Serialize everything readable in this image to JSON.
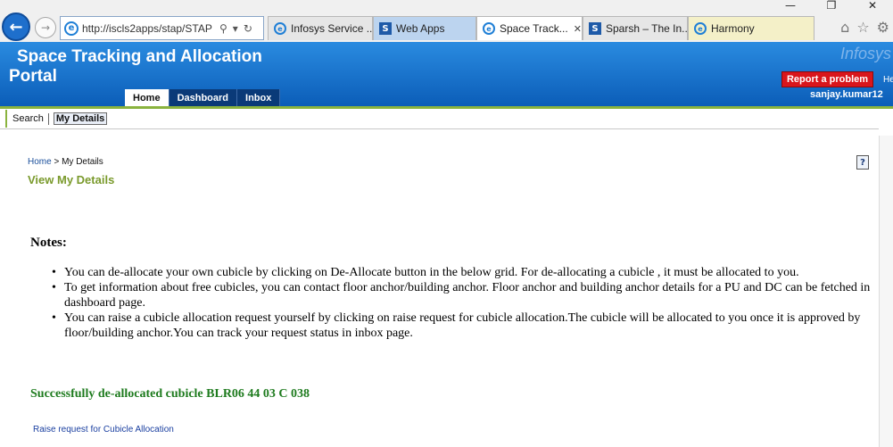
{
  "browser": {
    "address_url": "http://iscls2apps/stap/STAP",
    "tabs": [
      {
        "label": "Infosys Service ...",
        "icon": "ie-icon"
      },
      {
        "label": "Web Apps",
        "icon": "sharepoint-icon"
      },
      {
        "label": "Space Track...",
        "icon": "ie-icon"
      },
      {
        "label": "Sparsh – The In...",
        "icon": "sharepoint-icon"
      },
      {
        "label": "Harmony",
        "icon": "ie-icon"
      }
    ]
  },
  "header": {
    "title_line1": "Space Tracking and Allocation",
    "title_line2": "Portal",
    "brand": "Infosys",
    "report_button": "Report a problem",
    "help_link": "He",
    "user": "sanjay.kumar12"
  },
  "main_nav": [
    "Home",
    "Dashboard",
    "Inbox"
  ],
  "sub_nav": {
    "search": "Search",
    "my_details": "My Details"
  },
  "breadcrumb": {
    "home": "Home",
    "separator": " > ",
    "current": "My Details"
  },
  "page_title": "View My Details",
  "notes": {
    "title": "Notes:",
    "items": [
      "You can de-allocate your own cubicle by clicking on De-Allocate button in the below grid. For de-allocating a cubicle , it must be allocated to you.",
      "To get information about free cubicles, you can contact floor anchor/building anchor. Floor anchor and building anchor details for a PU and DC can be fetched in dashboard page.",
      "You can raise a cubicle allocation request yourself by clicking on raise request for cubicle allocation.The cubicle will be allocated to you once it is approved by floor/building anchor.You can track your request status in inbox page."
    ]
  },
  "success_message": "Successfully de-allocated cubicle BLR06 44 03 C 038",
  "raise_link": "Raise request for Cubicle Allocation",
  "colors": {
    "header_blue": "#0b5db8",
    "accent_green": "#8ab33e",
    "title_green": "#7a9a2c",
    "success_green": "#1e7b1e",
    "report_red": "#d9161c"
  }
}
